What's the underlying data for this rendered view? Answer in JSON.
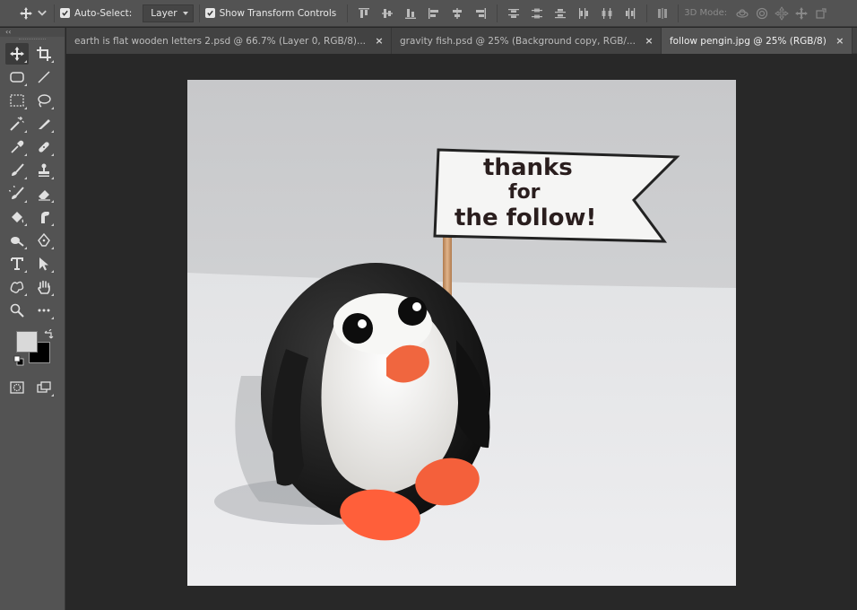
{
  "options_bar": {
    "auto_select_label": "Auto-Select:",
    "auto_select_checked": true,
    "layer_select_value": "Layer",
    "show_transform_label": "Show Transform Controls",
    "show_transform_checked": true,
    "mode_3d_label": "3D Mode:"
  },
  "toolbar": {
    "collapse_glyph": "‹‹",
    "foreground_color": "#d9d9d9",
    "background_color": "#000000"
  },
  "tabs": [
    {
      "label": "earth is flat wooden letters 2.psd @ 66.7% (Layer 0, RGB/8)...",
      "close": "×",
      "active": false
    },
    {
      "label": "gravity fish.psd @ 25% (Background copy, RGB/...",
      "close": "×",
      "active": false
    },
    {
      "label": "follow pengin.jpg @ 25% (RGB/8)",
      "close": "×",
      "active": true
    }
  ],
  "canvas": {
    "flag_text": {
      "line1": "thanks",
      "line2": "for",
      "line3": "the follow!"
    }
  }
}
